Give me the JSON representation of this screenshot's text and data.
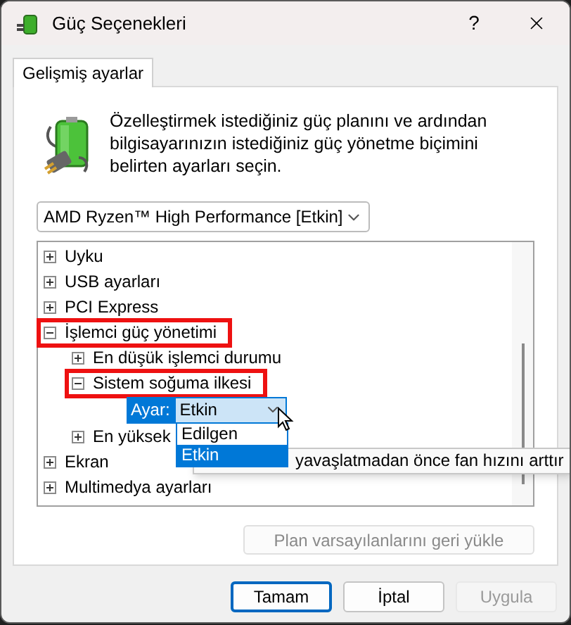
{
  "window": {
    "title": "Güç Seçenekleri",
    "help": "?"
  },
  "tabs": [
    {
      "label": "Gelişmiş ayarlar",
      "selected": true
    }
  ],
  "intro": "Özelleştirmek istediğiniz güç planını ve ardından bilgisayarınızın istediğiniz güç yönetme biçimini belirten ayarları seçin.",
  "plan_select": {
    "value": "AMD Ryzen™ High Performance [Etkin]"
  },
  "tree": [
    {
      "kind": "group",
      "label": "Uyku",
      "expanded": false,
      "highlighted": false
    },
    {
      "kind": "group",
      "label": "USB ayarları",
      "expanded": false,
      "highlighted": false
    },
    {
      "kind": "group",
      "label": "PCI Express",
      "expanded": false,
      "highlighted": false
    },
    {
      "kind": "group",
      "label": "İşlemci güç yönetimi",
      "expanded": true,
      "highlighted": true,
      "children": [
        {
          "kind": "group",
          "label": "En düşük işlemci durumu",
          "expanded": false,
          "highlighted": false
        },
        {
          "kind": "group",
          "label": "Sistem soğuma ilkesi",
          "expanded": true,
          "highlighted": true,
          "children": [
            {
              "kind": "setting",
              "label": "Ayar:",
              "value": "Etkin",
              "open": true,
              "options": [
                {
                  "label": "Edilgen",
                  "selected": false
                },
                {
                  "label": "Etkin",
                  "selected": true
                }
              ]
            }
          ]
        },
        {
          "kind": "group",
          "label": "En yüksek",
          "expanded": false,
          "highlighted": false
        }
      ]
    },
    {
      "kind": "group",
      "label": "Ekran",
      "expanded": false,
      "highlighted": false
    },
    {
      "kind": "group",
      "label": "Multimedya ayarları",
      "expanded": false,
      "highlighted": false
    }
  ],
  "tooltip": "yavaşlatmadan önce fan hızını arttır",
  "restore_button": {
    "label": "Plan varsayılanlarını geri yükle",
    "disabled": true
  },
  "buttons": [
    {
      "label": "Tamam",
      "disabled": false,
      "default": true
    },
    {
      "label": "İptal",
      "disabled": false,
      "default": false
    },
    {
      "label": "Uygula",
      "disabled": true,
      "default": false
    }
  ]
}
